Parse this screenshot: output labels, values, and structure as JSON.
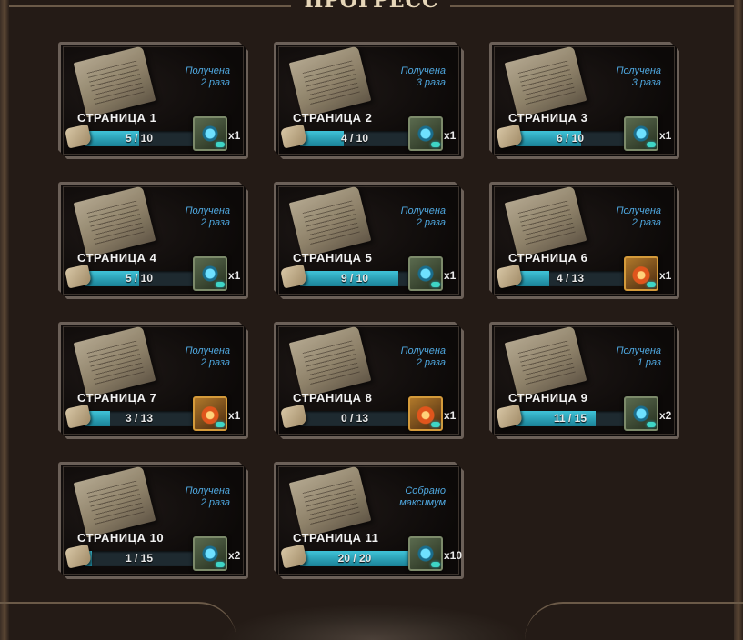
{
  "header": {
    "title": "ПРОГРЕСС"
  },
  "colors": {
    "status_text": "#4fa8e0",
    "bar_fill": "#2aa9c2",
    "background": "#241b16"
  },
  "cards": [
    {
      "label": "СТРАНИЦА 1",
      "status_line1": "Получена",
      "status_line2": "2 раза",
      "progress_text": "5 / 10",
      "progress": 0.5,
      "reward_icon": "blue-crystal-box-icon",
      "reward_count": "x1"
    },
    {
      "label": "СТРАНИЦА 2",
      "status_line1": "Получена",
      "status_line2": "3 раза",
      "progress_text": "4 / 10",
      "progress": 0.4,
      "reward_icon": "blue-crystal-box-icon",
      "reward_count": "x1"
    },
    {
      "label": "СТРАНИЦА 3",
      "status_line1": "Получена",
      "status_line2": "3 раза",
      "progress_text": "6 / 10",
      "progress": 0.6,
      "reward_icon": "blue-crystal-box-icon",
      "reward_count": "x1"
    },
    {
      "label": "СТРАНИЦА 4",
      "status_line1": "Получена",
      "status_line2": "2 раза",
      "progress_text": "5 / 10",
      "progress": 0.5,
      "reward_icon": "blue-crystal-box-icon",
      "reward_count": "x1"
    },
    {
      "label": "СТРАНИЦА 5",
      "status_line1": "Получена",
      "status_line2": "2 раза",
      "progress_text": "9 / 10",
      "progress": 0.9,
      "reward_icon": "blue-crystal-box-icon",
      "reward_count": "x1"
    },
    {
      "label": "СТРАНИЦА 6",
      "status_line1": "Получена",
      "status_line2": "2 раза",
      "progress_text": "4 / 13",
      "progress": 0.31,
      "reward_icon": "fire-box-icon",
      "reward_count": "x1"
    },
    {
      "label": "СТРАНИЦА 7",
      "status_line1": "Получена",
      "status_line2": "2 раза",
      "progress_text": "3 / 13",
      "progress": 0.23,
      "reward_icon": "fire-box-icon",
      "reward_count": "x1"
    },
    {
      "label": "СТРАНИЦА 8",
      "status_line1": "Получена",
      "status_line2": "2 раза",
      "progress_text": "0 / 13",
      "progress": 0,
      "reward_icon": "fire-box-icon",
      "reward_count": "x1"
    },
    {
      "label": "СТРАНИЦА 9",
      "status_line1": "Получена",
      "status_line2": "1 раз",
      "progress_text": "11 / 15",
      "progress": 0.73,
      "reward_icon": "blue-crystal-box-icon",
      "reward_count": "x2"
    },
    {
      "label": "СТРАНИЦА 10",
      "status_line1": "Получена",
      "status_line2": "2 раза",
      "progress_text": "1 / 15",
      "progress": 0.07,
      "reward_icon": "blue-crystal-box-icon",
      "reward_count": "x2"
    },
    {
      "label": "СТРАНИЦА 11",
      "status_line1": "Собрано",
      "status_line2": "максимум",
      "progress_text": "20 / 20",
      "progress": 1,
      "reward_icon": "blue-crystal-box-icon",
      "reward_count": "x10"
    }
  ]
}
